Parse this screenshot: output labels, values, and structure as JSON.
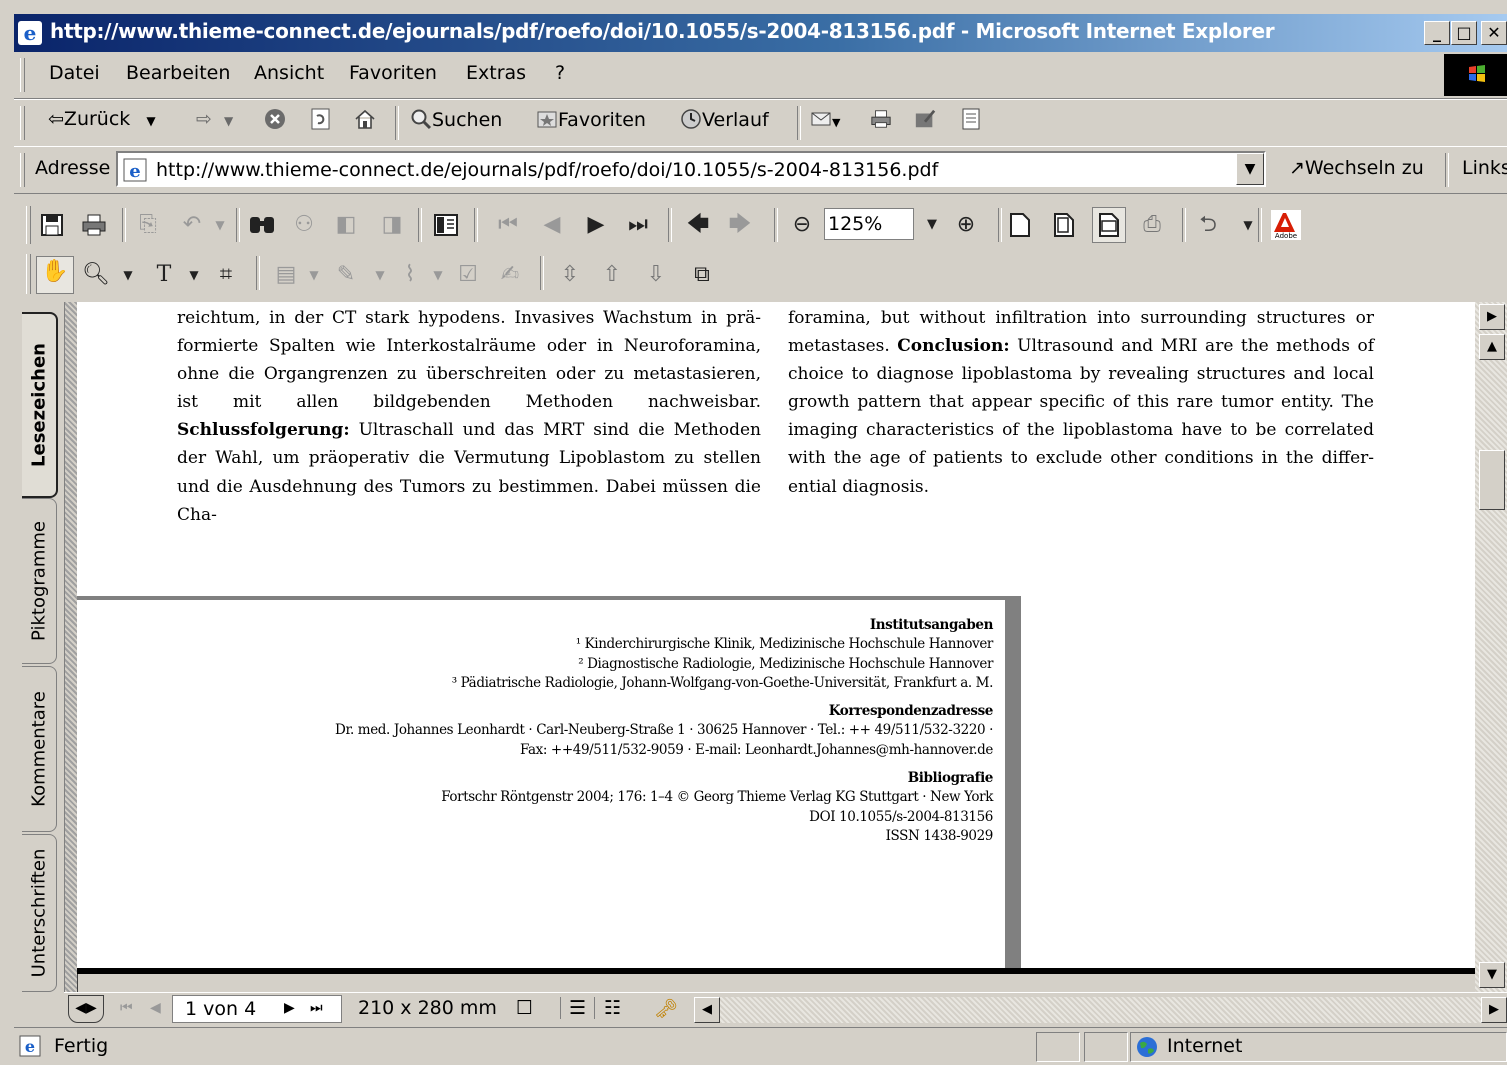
{
  "window": {
    "title": "http://www.thieme-connect.de/ejournals/pdf/roefo/doi/10.1055/s-2004-813156.pdf - Microsoft Internet Explorer",
    "minimize": "_",
    "maximize": "□",
    "close": "✕"
  },
  "menu": [
    "Datei",
    "Bearbeiten",
    "Ansicht",
    "Favoriten",
    "Extras",
    "?"
  ],
  "nav": {
    "back": "Zurück",
    "search": "Suchen",
    "favorites": "Favoriten",
    "history": "Verlauf"
  },
  "address": {
    "label": "Adresse",
    "url": "http://www.thieme-connect.de/ejournals/pdf/roefo/doi/10.1055/s-2004-813156.pdf",
    "go": "Wechseln zu",
    "links": "Links"
  },
  "acrobat": {
    "zoom": "125%",
    "adobe_label": "Adobe"
  },
  "sidetabs": [
    "Lesezeichen",
    "Piktogramme",
    "Kommentare",
    "Unterschriften"
  ],
  "document": {
    "left_column": [
      {
        "text": "reichtum, in der CT stark hypodens. Invasives Wachstum in prä-formierte Spalten wie Interkostalräume oder in Neuroforamina, ohne die Organgrenzen zu überschreiten oder zu metastasieren, ist mit allen bildgebenden Methoden nachweisbar. "
      },
      {
        "bold": "Schlussfolgerung:"
      },
      {
        "text": " Ultraschall und das MRT sind die Methoden der Wahl, um präoperativ die Vermutung Lipoblastom zu stellen und die Ausdehnung des Tumors zu bestimmen. Dabei müssen die Cha-"
      }
    ],
    "right_column": [
      {
        "text": "foramina, but without infiltration into surrounding structures or metastases. "
      },
      {
        "bold": "Conclusion:"
      },
      {
        "text": " Ultrasound and MRI are the methods of choice to diagnose lipoblastoma by revealing structures and local growth pattern that appear specific of this rare tumor entity. The imaging characteristics of the lipoblastoma have to be correlated with the age of patients to exclude other conditions in the differ-ential diagnosis."
      }
    ],
    "footer": {
      "inst_heading": "Institutsangaben",
      "inst_1": "¹ Kinderchirurgische Klinik, Medizinische Hochschule Hannover",
      "inst_2": "² Diagnostische Radiologie, Medizinische Hochschule Hannover",
      "inst_3": "³ Pädiatrische Radiologie, Johann-Wolfgang-von-Goethe-Universität, Frankfurt a. M.",
      "corr_heading": "Korrespondenzadresse",
      "corr_1": "Dr. med. Johannes Leonhardt · Carl-Neuberg-Straße 1 · 30625 Hannover · Tel.: ++ 49/511/532-3220 ·",
      "corr_2": "Fax: ++49/511/532-9059 · E-mail: Leonhardt.Johannes@mh-hannover.de",
      "bib_heading": "Bibliografie",
      "bib_1": "Fortschr Röntgenstr 2004; 176: 1–4 © Georg Thieme Verlag KG Stuttgart · New York",
      "bib_2": "DOI 10.1055/s-2004-813156",
      "bib_3": "ISSN 1438-9029"
    }
  },
  "acro_status": {
    "page": "1 von 4",
    "size": "210 x 280 mm"
  },
  "ie_status": {
    "state": "Fertig",
    "zone": "Internet"
  },
  "colors": {
    "title_start": "#0a246a",
    "title_end": "#a6caf0",
    "chrome": "#d4d0c8"
  }
}
